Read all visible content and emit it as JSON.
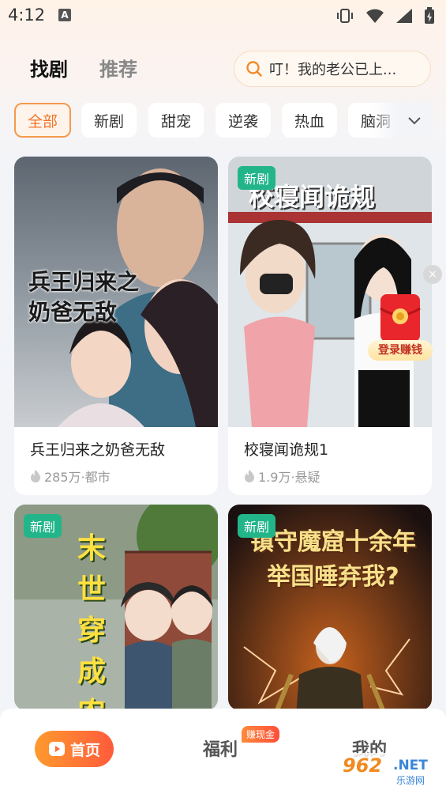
{
  "status": {
    "time": "4:12",
    "notif_glyph": "A"
  },
  "top_tabs": [
    {
      "label": "找剧",
      "active": true
    },
    {
      "label": "推荐",
      "active": false
    }
  ],
  "search": {
    "text": "叮！我的老公已上..."
  },
  "chips": [
    {
      "label": "全部",
      "active": true
    },
    {
      "label": "新剧"
    },
    {
      "label": "甜宠"
    },
    {
      "label": "逆袭"
    },
    {
      "label": "热血"
    },
    {
      "label": "脑洞"
    }
  ],
  "cards": [
    {
      "title": "兵王归来之奶爸无敌",
      "meta": "285万·都市",
      "poster_text": "兵王归来之奶爸无敌",
      "badge": ""
    },
    {
      "title": "校寝闻诡规1",
      "meta": "1.9万·悬疑",
      "poster_text": "校寝闻诡规",
      "badge": "新剧"
    },
    {
      "title": "",
      "meta": "",
      "poster_text": "末世穿成农家",
      "badge": "新剧"
    },
    {
      "title": "",
      "meta": "",
      "poster_text": "镇守魔窟十余年 举国唾弃我?",
      "badge": "新剧"
    }
  ],
  "float": {
    "close": "×",
    "login_earn": "登录赚钱"
  },
  "bottom_nav": {
    "home": "首页",
    "welfare": "福利",
    "welfare_badge": "赚现金",
    "mine": "我的"
  },
  "watermark": {
    "num": "962",
    "net": ".NET",
    "cn": "乐游网"
  },
  "colors": {
    "accent": "#f0762a",
    "new_badge": "#22b58a"
  }
}
